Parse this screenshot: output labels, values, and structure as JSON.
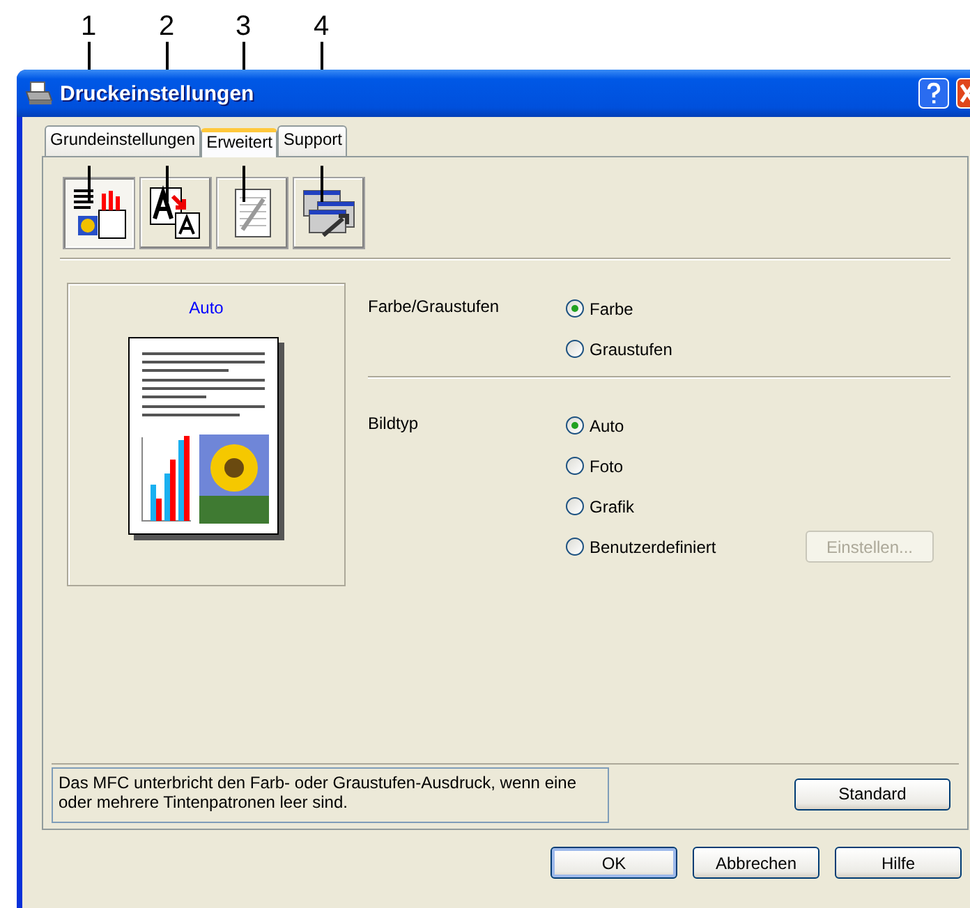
{
  "callouts": [
    "1",
    "2",
    "3",
    "4"
  ],
  "window": {
    "title": "Druckeinstellungen"
  },
  "tabs": [
    {
      "label": "Grundeinstellungen",
      "selected": false
    },
    {
      "label": "Erweitert",
      "selected": true
    },
    {
      "label": "Support",
      "selected": false
    }
  ],
  "toolbar": [
    {
      "kind": "document",
      "selected": true
    },
    {
      "kind": "fonts",
      "selected": false
    },
    {
      "kind": "copy",
      "selected": false
    },
    {
      "kind": "windows",
      "selected": false
    }
  ],
  "preview": {
    "title": "Auto"
  },
  "groups": [
    {
      "label": "Farbe/Graustufen",
      "options": [
        {
          "label": "Farbe",
          "selected": true
        },
        {
          "label": "Graustufen",
          "selected": false
        }
      ]
    },
    {
      "label": "Bildtyp",
      "options": [
        {
          "label": "Auto",
          "selected": true
        },
        {
          "label": "Foto",
          "selected": false
        },
        {
          "label": "Grafik",
          "selected": false
        },
        {
          "label": "Benutzerdefiniert",
          "selected": false
        }
      ],
      "option_button": {
        "label": "Einstellen...",
        "disabled": true
      }
    }
  ],
  "description": "Das MFC unterbricht den Farb- oder Graustufen-Ausdruck, wenn eine oder mehrere Tintenpatronen leer sind.",
  "standard_button": "Standard",
  "buttons": [
    {
      "label": "OK",
      "default": true
    },
    {
      "label": "Abbrechen",
      "default": false
    },
    {
      "label": "Hilfe",
      "default": false
    }
  ]
}
